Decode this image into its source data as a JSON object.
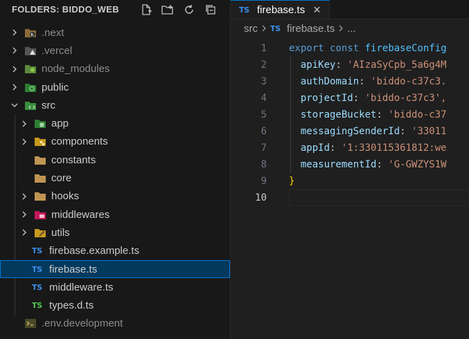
{
  "sidebar": {
    "title": "FOLDERS: BIDDO_WEB",
    "actions": [
      "new-file-icon",
      "new-folder-icon",
      "refresh-icon",
      "collapse-all-icon"
    ],
    "items": [
      {
        "label": ".next",
        "type": "folder",
        "dim": true,
        "expanded": false,
        "icon": "next-folder-icon",
        "color": "#8c6a3b"
      },
      {
        "label": ".vercel",
        "type": "folder",
        "dim": true,
        "expanded": false,
        "icon": "vercel-folder-icon",
        "color": "#8c8c8c"
      },
      {
        "label": "node_modules",
        "type": "folder",
        "dim": true,
        "expanded": false,
        "icon": "node-folder-icon",
        "color": "#7cb342"
      },
      {
        "label": "public",
        "type": "folder",
        "dim": false,
        "expanded": false,
        "icon": "public-folder-icon",
        "color": "#43a047"
      },
      {
        "label": "src",
        "type": "folder",
        "dim": false,
        "expanded": true,
        "icon": "src-folder-icon",
        "color": "#4caf50"
      },
      {
        "label": "app",
        "type": "folder",
        "indent": 1,
        "expanded": false,
        "icon": "app-folder-icon",
        "color": "#43a047"
      },
      {
        "label": "components",
        "type": "folder",
        "indent": 1,
        "expanded": false,
        "icon": "components-folder-icon",
        "color": "#f9a825"
      },
      {
        "label": "constants",
        "type": "folder",
        "indent": 1,
        "icon": "folder-icon",
        "color": "#c09553"
      },
      {
        "label": "core",
        "type": "folder",
        "indent": 1,
        "icon": "folder-icon",
        "color": "#c09553"
      },
      {
        "label": "hooks",
        "type": "folder",
        "indent": 1,
        "expanded": false,
        "icon": "hooks-folder-icon",
        "color": "#c09553"
      },
      {
        "label": "middlewares",
        "type": "folder",
        "indent": 1,
        "expanded": false,
        "icon": "middlewares-folder-icon",
        "color": "#e53935"
      },
      {
        "label": "utils",
        "type": "folder",
        "indent": 1,
        "expanded": false,
        "icon": "utils-folder-icon",
        "color": "#fbc02d"
      },
      {
        "label": "firebase.example.ts",
        "type": "ts",
        "indent": 1
      },
      {
        "label": "firebase.ts",
        "type": "ts",
        "indent": 1,
        "selected": true
      },
      {
        "label": "middleware.ts",
        "type": "ts",
        "indent": 1
      },
      {
        "label": "types.d.ts",
        "type": "ts-d",
        "indent": 1
      },
      {
        "label": ".env.development",
        "type": "env",
        "dim": true
      }
    ]
  },
  "editor": {
    "tab": {
      "label": "firebase.ts",
      "lang_badge": "TS",
      "close": "×"
    },
    "breadcrumb": {
      "folder": "src",
      "file": "firebase.ts",
      "more": "..."
    },
    "ts_badge": "TS",
    "lines": [
      {
        "n": "1"
      },
      {
        "n": "2"
      },
      {
        "n": "3"
      },
      {
        "n": "4"
      },
      {
        "n": "5"
      },
      {
        "n": "6"
      },
      {
        "n": "7"
      },
      {
        "n": "8"
      },
      {
        "n": "9"
      },
      {
        "n": "10"
      }
    ],
    "code": {
      "export": "export",
      "const": "const",
      "name": "firebaseConfig",
      "keys": [
        "apiKey",
        "authDomain",
        "projectId",
        "storageBucket",
        "messagingSenderId",
        "appId",
        "measurementId"
      ],
      "values": [
        "'AIzaSyCpb_5a6g4M",
        "'biddo-c37c3.",
        "'biddo-c37c3',",
        "'biddo-c37",
        "'33011",
        "'1:330115361812:we",
        "'G-GWZYS1W"
      ],
      "close": "}"
    }
  }
}
